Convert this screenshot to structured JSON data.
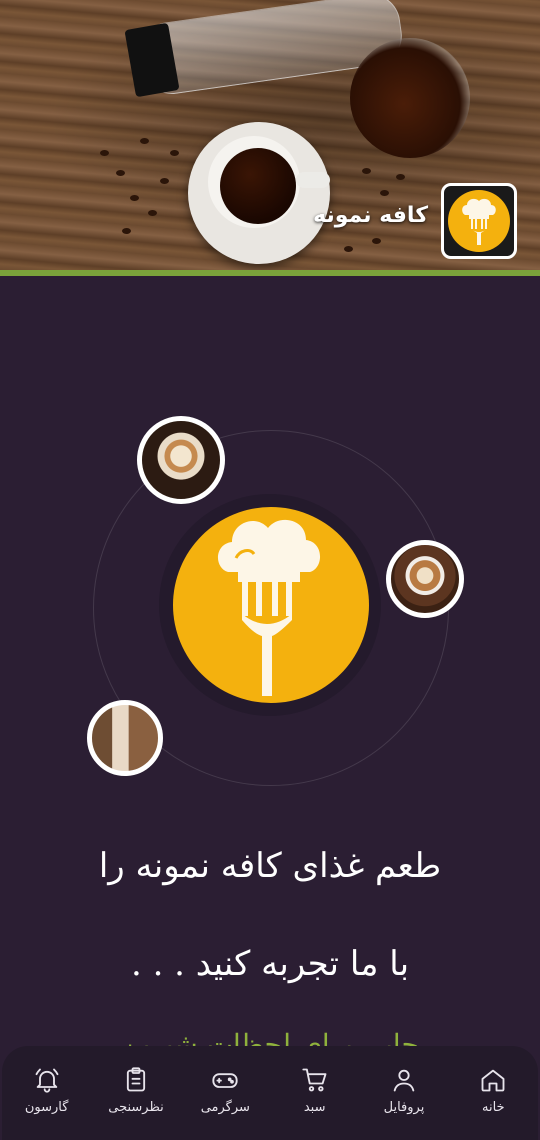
{
  "header": {
    "brand_name": "کافه نمونه",
    "accent_color": "#7aa23a",
    "logo_color": "#f4b10e"
  },
  "hero": {
    "slogan_line1": "طعم غذای کافه نمونه را",
    "slogan_line2": "با ما تجربه کنید . . .",
    "slogan_partial": "جایی برای لحظات شیرین"
  },
  "bottom_nav": {
    "items": [
      {
        "label": "گارسون",
        "icon": "bell-icon"
      },
      {
        "label": "نظرسنجی",
        "icon": "clipboard-icon"
      },
      {
        "label": "سرگرمی",
        "icon": "gamepad-icon"
      },
      {
        "label": "سبد",
        "icon": "cart-icon"
      },
      {
        "label": "پروفایل",
        "icon": "user-icon"
      },
      {
        "label": "خانه",
        "icon": "home-icon"
      }
    ]
  }
}
